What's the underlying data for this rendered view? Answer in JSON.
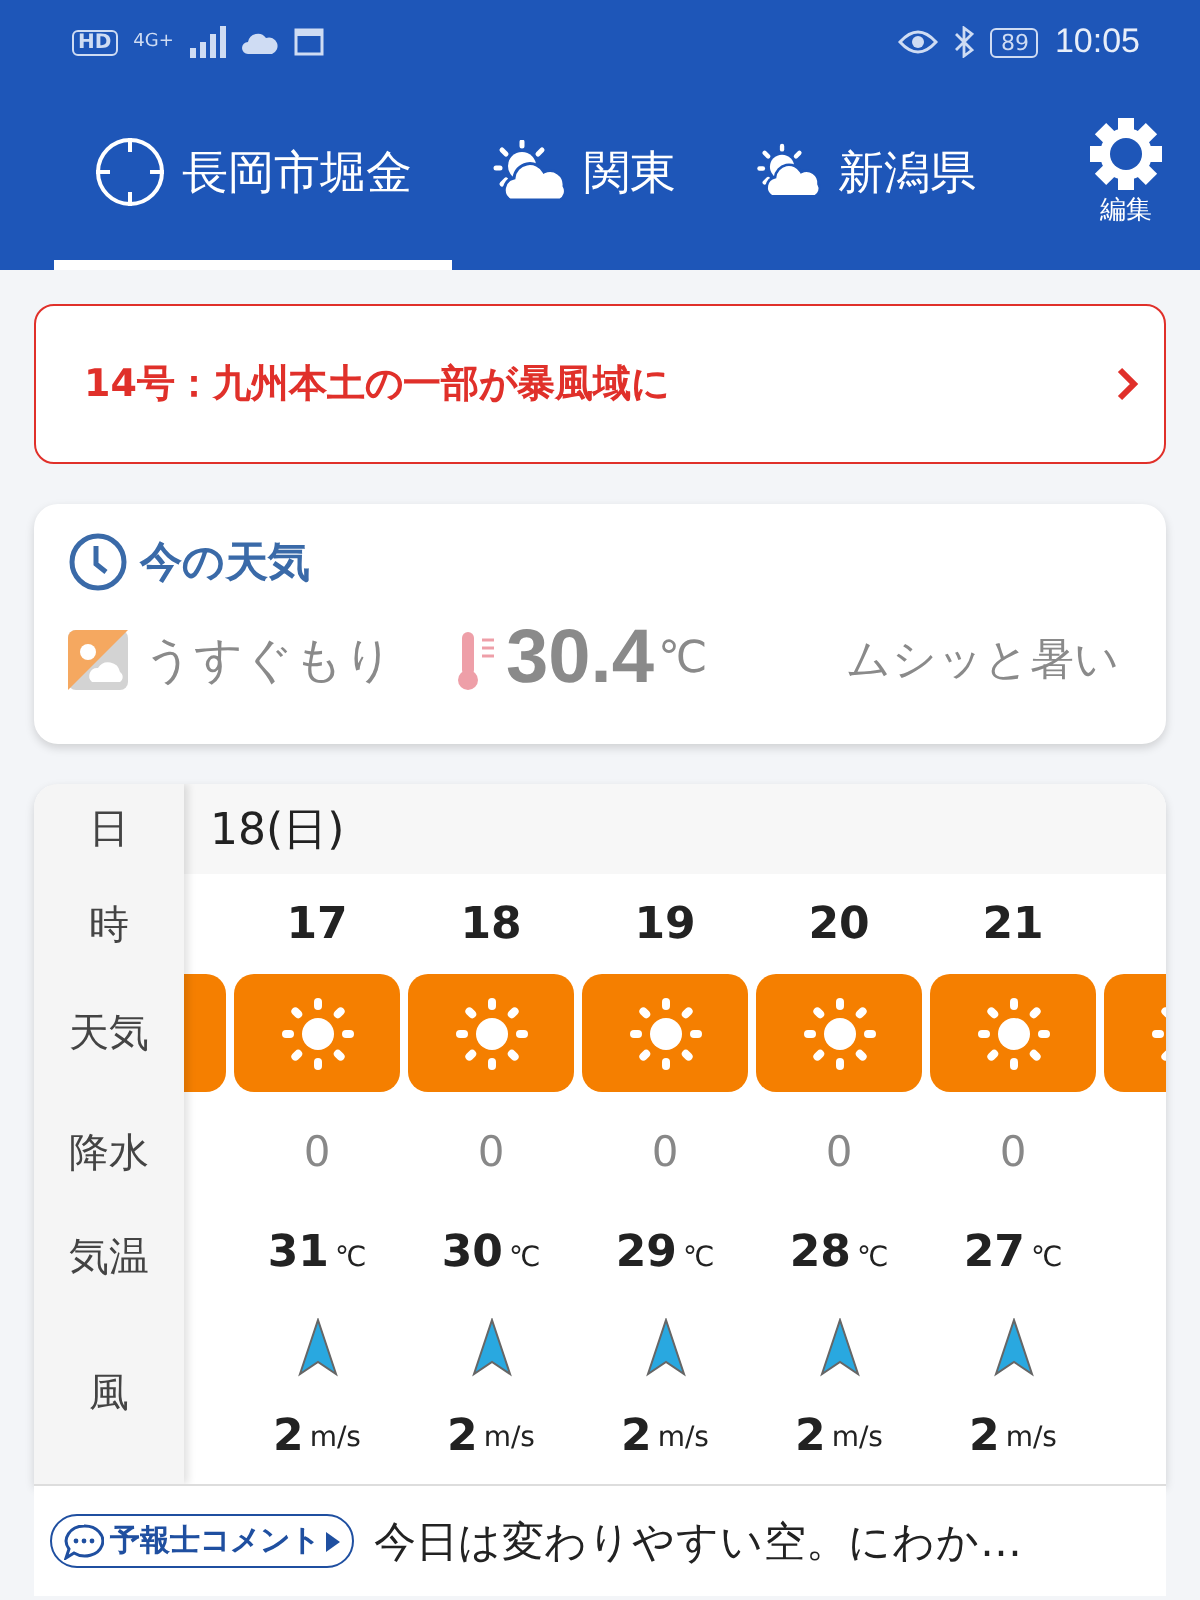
{
  "status_bar": {
    "left": [
      "HD",
      "4G+"
    ],
    "battery": "89",
    "time": "10:05"
  },
  "tabs": [
    {
      "label": "長岡市堀金",
      "selected": true
    },
    {
      "label": "関東",
      "selected": false
    },
    {
      "label": "新潟県",
      "selected": false
    }
  ],
  "settings": {
    "label": "編集"
  },
  "alert": {
    "text": "14号：九州本土の一部が暴風域に"
  },
  "current": {
    "title": "今の天気",
    "condition": "うすぐもり",
    "temperature": "30.4",
    "unit": "℃",
    "feeling": "ムシッと暑い"
  },
  "forecast": {
    "row_labels": [
      "日",
      "時",
      "天気",
      "降水",
      "気温",
      "風"
    ],
    "date": "18(日)",
    "columns": [
      {
        "hour": "17",
        "precip": "0",
        "temp": "31",
        "temp_unit": "℃",
        "wind": "2",
        "wind_unit": "m/s"
      },
      {
        "hour": "18",
        "precip": "0",
        "temp": "30",
        "temp_unit": "℃",
        "wind": "2",
        "wind_unit": "m/s"
      },
      {
        "hour": "19",
        "precip": "0",
        "temp": "29",
        "temp_unit": "℃",
        "wind": "2",
        "wind_unit": "m/s"
      },
      {
        "hour": "20",
        "precip": "0",
        "temp": "28",
        "temp_unit": "℃",
        "wind": "2",
        "wind_unit": "m/s"
      },
      {
        "hour": "21",
        "precip": "0",
        "temp": "27",
        "temp_unit": "℃",
        "wind": "2",
        "wind_unit": "m/s"
      }
    ]
  },
  "comment": {
    "button": "予報士コメント",
    "text": "今日は変わりやすい空。にわか…"
  }
}
